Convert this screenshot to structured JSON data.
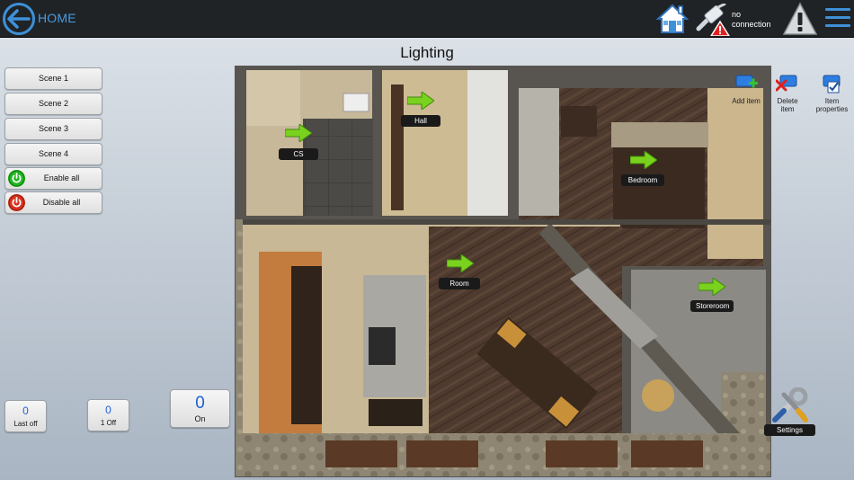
{
  "header": {
    "home_label": "HOME",
    "connection_status": "no connection",
    "icons": [
      "back-arrow-icon",
      "house-icon",
      "network-cable-icon",
      "warning-icon",
      "hamburger-menu-icon"
    ]
  },
  "page": {
    "title": "Lighting"
  },
  "scenes": [
    {
      "label": "Scene 1"
    },
    {
      "label": "Scene 2"
    },
    {
      "label": "Scene 3"
    },
    {
      "label": "Scene 4"
    }
  ],
  "power_buttons": [
    {
      "label": "Enable all",
      "color": "#1db31d"
    },
    {
      "label": "Disable all",
      "color": "#d8321e"
    }
  ],
  "counters": {
    "last_off": {
      "value": "0",
      "label": "Last off"
    },
    "off": {
      "value": "0",
      "label": "1 Off"
    },
    "on": {
      "value": "0",
      "label": "On"
    }
  },
  "rooms": [
    {
      "label": "CS"
    },
    {
      "label": "Hall"
    },
    {
      "label": "Bedroom"
    },
    {
      "label": "Room"
    },
    {
      "label": "Storeroom"
    }
  ],
  "tools": {
    "add_item": "Add item",
    "delete_item": "Delete item",
    "item_properties": "Item properties",
    "settings": "Settings"
  },
  "colors": {
    "accent": "#3e90d8",
    "counter_value": "#1e5fd6",
    "arrow_green": "#7ad21f",
    "topbar": "#1f2326"
  }
}
